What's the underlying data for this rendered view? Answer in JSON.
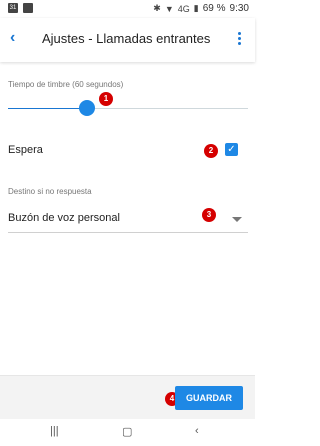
{
  "status_bar": {
    "notif1": "31",
    "bluetooth_icon": "bluetooth-icon",
    "signal": "4G",
    "battery_percent": "69 %",
    "time": "9:30"
  },
  "app_bar": {
    "title": "Ajustes - Llamadas entrantes"
  },
  "ring_time": {
    "label": "Tiempo de timbre (60 segundos)",
    "value_fraction": 0.33
  },
  "espera": {
    "label": "Espera",
    "checked": true
  },
  "no_answer": {
    "label": "Destino si no respuesta",
    "value": "Buzón de voz personal"
  },
  "badges": [
    "1",
    "2",
    "3",
    "4"
  ],
  "footer": {
    "save_label": "GUARDAR"
  },
  "colors": {
    "accent": "#1e88e5",
    "badge": "#d50000"
  }
}
